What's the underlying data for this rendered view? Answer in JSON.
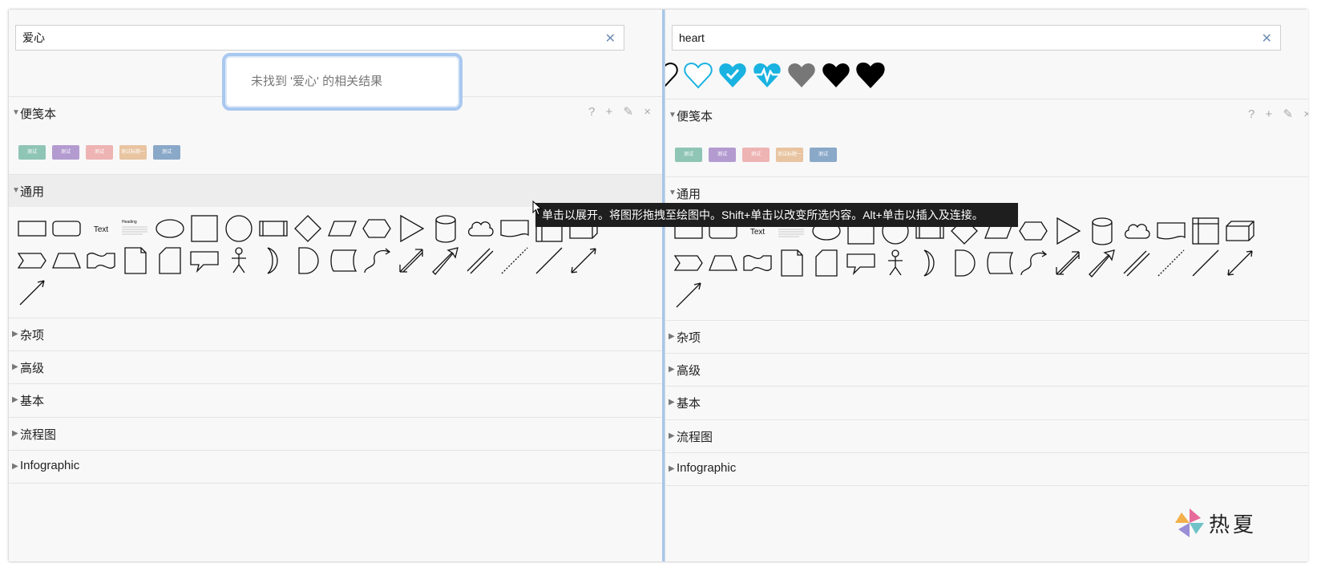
{
  "left_panel": {
    "search_value": "爱心",
    "no_result": "未找到 '爱心' 的相关结果",
    "sections": [
      {
        "id": "scratchpad",
        "title": "便笺本"
      },
      {
        "id": "general",
        "title": "通用"
      },
      {
        "id": "misc",
        "title": "杂项"
      },
      {
        "id": "advanced",
        "title": "高级"
      },
      {
        "id": "basic",
        "title": "基本"
      },
      {
        "id": "flowchart",
        "title": "流程图"
      },
      {
        "id": "infographic",
        "title": "Infographic"
      }
    ],
    "text_shape_label": "Text",
    "heading_shape_label": "Heading"
  },
  "right_panel": {
    "search_value": "heart",
    "sections": [
      {
        "id": "scratchpad",
        "title": "便笺本"
      },
      {
        "id": "general",
        "title": "通用"
      },
      {
        "id": "misc",
        "title": "杂项"
      },
      {
        "id": "advanced",
        "title": "高级"
      },
      {
        "id": "basic",
        "title": "基本"
      },
      {
        "id": "flowchart",
        "title": "流程图"
      },
      {
        "id": "infographic",
        "title": "Infographic"
      }
    ]
  },
  "scratchpad_tools": {
    "help": "?",
    "add": "+",
    "edit": "✎",
    "close": "×"
  },
  "clear_icon": "✕",
  "tooltip": "单击以展开。将图形拖拽至绘图中。Shift+单击以改变所选内容。Alt+单击以插入及连接。",
  "chips": [
    {
      "color": "#8fc5b4",
      "text": "测试"
    },
    {
      "color": "#b39bd0",
      "text": "测试"
    },
    {
      "color": "#eeb3b3",
      "text": "测试"
    },
    {
      "color": "#e8c4a0",
      "text": "测试标题一"
    },
    {
      "color": "#8aa8c8",
      "text": "测试"
    }
  ],
  "heart_colors": [
    "#ffffff",
    "#ffffff",
    "#1ab2e0",
    "#1ab2e0",
    "#777777",
    "#000000",
    "#000000"
  ],
  "logo_text": "热夏"
}
